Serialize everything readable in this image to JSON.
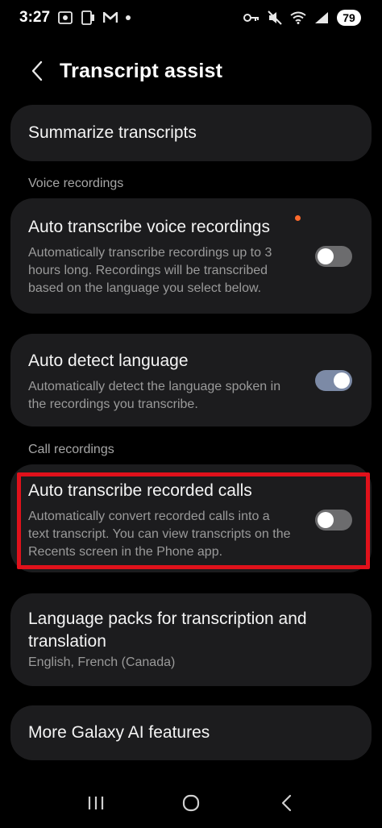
{
  "status_bar": {
    "time": "3:27",
    "battery": "79",
    "icons": [
      "screenshot-icon",
      "sim-icon",
      "gmail-icon",
      "notification-dot-icon",
      "key-icon",
      "mute-icon",
      "wifi-icon",
      "signal-icon"
    ]
  },
  "header": {
    "title": "Transcript assist",
    "back_icon": "chevron-left-icon"
  },
  "summarize": {
    "title": "Summarize transcripts"
  },
  "sections": {
    "voice": "Voice recordings",
    "calls": "Call recordings"
  },
  "auto_transcribe_voice": {
    "title": "Auto transcribe voice recordings",
    "desc_lines": [
      "Automatically transcribe recordings up to 3",
      "hours long. Recordings will be transcribed",
      "based on the language you select below."
    ],
    "enabled": false,
    "new_badge_color": "#ff6a2c"
  },
  "auto_detect_language": {
    "title": "Auto detect language",
    "desc_lines": [
      "Automatically detect the language spoken in",
      "the recordings you transcribe."
    ],
    "enabled": true
  },
  "auto_transcribe_calls": {
    "title": "Auto transcribe recorded calls",
    "desc_lines": [
      "Automatically convert recorded calls into a",
      "text transcript. You can view transcripts on the",
      "Recents screen in the Phone app."
    ],
    "enabled": false,
    "highlight_color": "#e0111b"
  },
  "language_packs": {
    "title_lines": [
      "Language packs for transcription and",
      "translation"
    ],
    "subtitle": "English, French (Canada)"
  },
  "more_ai": {
    "title": "More Galaxy AI features"
  },
  "nav": {
    "recents_icon": "recents-icon",
    "home_icon": "home-icon",
    "back_icon": "back-icon"
  },
  "colors": {
    "background": "#000000",
    "card": "#1c1c1e",
    "toggle_on": "#7c8aa6",
    "toggle_off": "#6c6c6e"
  }
}
